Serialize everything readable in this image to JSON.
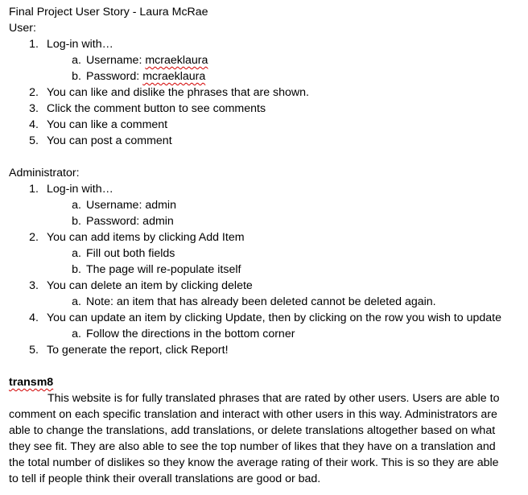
{
  "doc_title": "Final Project User Story - Laura McRae",
  "user_section": {
    "heading": "User:",
    "steps": [
      {
        "num": "1.",
        "text": "Log-in with…",
        "sub": [
          {
            "letter": "a.",
            "label": "Username:",
            "value": "mcraeklaura"
          },
          {
            "letter": "b.",
            "label": "Password:",
            "value": "mcraeklaura"
          }
        ]
      },
      {
        "num": "2.",
        "text": "You can like and dislike the phrases that are shown."
      },
      {
        "num": "3.",
        "text": "Click the comment button to see comments"
      },
      {
        "num": "4.",
        "text": "You can like a comment"
      },
      {
        "num": "5.",
        "text": "You can post a comment"
      }
    ]
  },
  "admin_section": {
    "heading": "Administrator:",
    "steps": [
      {
        "num": "1.",
        "text": "Log-in with…",
        "sub": [
          {
            "letter": "a.",
            "text": "Username: admin"
          },
          {
            "letter": "b.",
            "text": "Password: admin"
          }
        ]
      },
      {
        "num": "2.",
        "text": "You can add items by clicking Add Item",
        "sub": [
          {
            "letter": "a.",
            "text": "Fill out both fields"
          },
          {
            "letter": "b.",
            "text": "The page will re-populate itself"
          }
        ]
      },
      {
        "num": "3.",
        "text": "You can delete an item by clicking delete",
        "sub": [
          {
            "letter": "a.",
            "text": "Note: an item that has already been deleted cannot be deleted again."
          }
        ]
      },
      {
        "num": "4.",
        "text": "You can update an item by clicking Update, then by clicking on the row you wish to update",
        "sub": [
          {
            "letter": "a.",
            "text": "Follow the directions in the bottom corner"
          }
        ]
      },
      {
        "num": "5.",
        "text": "To generate the report, click Report!"
      }
    ]
  },
  "app_name": "transm8",
  "description": "This website is for fully translated phrases that are rated by other users. Users are able to comment on each specific translation and interact with other users in this way. Administrators are able to change the translations, add translations, or delete translations altogether based on what they see fit. They are also able to see the top number of likes that they have on a translation and the total number of dislikes so they know the average rating of their work. This is so they are able to tell if people think their overall translations are good or bad."
}
